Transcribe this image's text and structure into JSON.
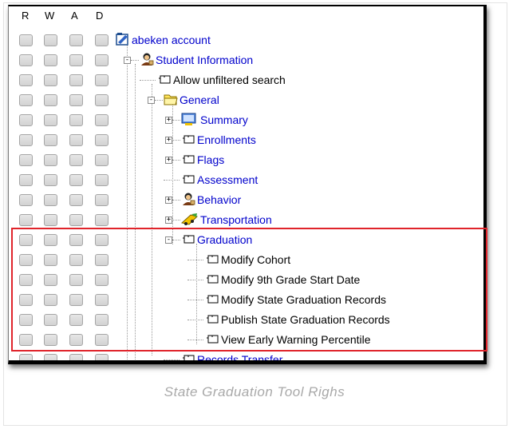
{
  "permission_headers": [
    "R",
    "W",
    "A",
    "D"
  ],
  "tree_nodes": [
    {
      "label": "abeken account",
      "icon": "account-icon",
      "style": "link"
    },
    {
      "label": "Student Information",
      "icon": "student-information-icon",
      "style": "link"
    },
    {
      "label": "Allow unfiltered search",
      "icon": "folder-tool-icon",
      "style": "plain"
    },
    {
      "label": "General",
      "icon": "open-folder-icon",
      "style": "link"
    },
    {
      "label": "Summary",
      "icon": "summary-icon",
      "style": "link"
    },
    {
      "label": "Enrollments",
      "icon": "folder-tool-icon",
      "style": "link"
    },
    {
      "label": "Flags",
      "icon": "folder-tool-icon",
      "style": "link"
    },
    {
      "label": "Assessment",
      "icon": "folder-tool-icon",
      "style": "link"
    },
    {
      "label": "Behavior",
      "icon": "behavior-icon",
      "style": "link"
    },
    {
      "label": "Transportation",
      "icon": "transportation-icon",
      "style": "link"
    },
    {
      "label": "Graduation",
      "icon": "folder-tool-icon",
      "style": "link"
    },
    {
      "label": "Modify Cohort",
      "icon": "folder-tool-icon",
      "style": "plain"
    },
    {
      "label": "Modify 9th Grade Start Date",
      "icon": "folder-tool-icon",
      "style": "plain"
    },
    {
      "label": "Modify State Graduation Records",
      "icon": "folder-tool-icon",
      "style": "plain"
    },
    {
      "label": "Publish State Graduation Records",
      "icon": "folder-tool-icon",
      "style": "plain"
    },
    {
      "label": "View Early Warning Percentile",
      "icon": "folder-tool-icon",
      "style": "plain"
    },
    {
      "label": "Records Transfer",
      "icon": "folder-tool-icon",
      "style": "link"
    }
  ],
  "caption": "State Graduation Tool Righs",
  "colors": {
    "link": "#0000cc",
    "highlight_border": "#e0242b",
    "caption": "#a9a9a9"
  }
}
